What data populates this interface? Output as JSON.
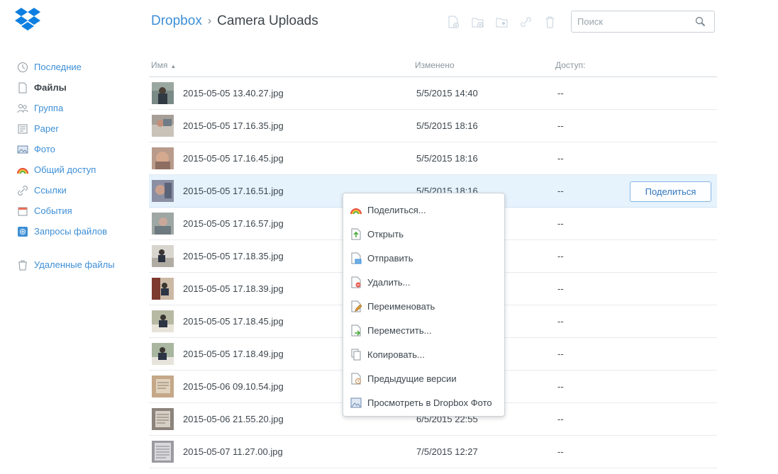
{
  "breadcrumb": {
    "root": "Dropbox",
    "separator": "›",
    "current": "Camera Uploads"
  },
  "search": {
    "placeholder": "Поиск",
    "value": ""
  },
  "toolbar": {
    "icons": [
      "new-file-icon",
      "new-folder-icon",
      "shared-folder-icon",
      "link-icon",
      "trash-icon"
    ]
  },
  "sidebar": {
    "items": [
      {
        "label": "Последние",
        "icon": "clock-icon"
      },
      {
        "label": "Файлы",
        "icon": "file-icon",
        "active": true
      },
      {
        "label": "Группа",
        "icon": "group-icon"
      },
      {
        "label": "Paper",
        "icon": "paper-icon"
      },
      {
        "label": "Фото",
        "icon": "photo-icon"
      },
      {
        "label": "Общий доступ",
        "icon": "rainbow-icon"
      },
      {
        "label": "Ссылки",
        "icon": "link-icon"
      },
      {
        "label": "События",
        "icon": "calendar-icon"
      },
      {
        "label": "Запросы файлов",
        "icon": "file-request-icon"
      },
      {
        "label": "Удаленные файлы",
        "icon": "trash-icon"
      }
    ]
  },
  "list": {
    "headers": {
      "name": "Имя",
      "sort_arrow": "▲",
      "modified": "Изменено",
      "access": "Доступ:"
    },
    "rows": [
      {
        "name": "2015-05-05 13.40.27.jpg",
        "modified": "5/5/2015 14:40",
        "access": "--"
      },
      {
        "name": "2015-05-05 17.16.35.jpg",
        "modified": "5/5/2015 18:16",
        "access": "--"
      },
      {
        "name": "2015-05-05 17.16.45.jpg",
        "modified": "5/5/2015 18:16",
        "access": "--"
      },
      {
        "name": "2015-05-05 17.16.51.jpg",
        "modified": "5/5/2015 18:16",
        "access": "--",
        "selected": true
      },
      {
        "name": "2015-05-05 17.16.57.jpg",
        "modified": "",
        "access": "--"
      },
      {
        "name": "2015-05-05 17.18.35.jpg",
        "modified": "",
        "access": "--"
      },
      {
        "name": "2015-05-05 17.18.39.jpg",
        "modified": "",
        "access": "--"
      },
      {
        "name": "2015-05-05 17.18.45.jpg",
        "modified": "",
        "access": "--"
      },
      {
        "name": "2015-05-05 17.18.49.jpg",
        "modified": "",
        "access": "--"
      },
      {
        "name": "2015-05-06 09.10.54.jpg",
        "modified": "",
        "access": "--"
      },
      {
        "name": "2015-05-06 21.55.20.jpg",
        "modified": "6/5/2015 22:55",
        "access": "--"
      },
      {
        "name": "2015-05-07 11.27.00.jpg",
        "modified": "7/5/2015 12:27",
        "access": "--"
      }
    ],
    "share_button": "Поделиться"
  },
  "context_menu": {
    "items": [
      {
        "label": "Поделиться...",
        "icon": "rainbow-icon"
      },
      {
        "label": "Открыть",
        "icon": "open-file-icon"
      },
      {
        "label": "Отправить",
        "icon": "send-file-icon"
      },
      {
        "label": "Удалить...",
        "icon": "delete-file-icon"
      },
      {
        "label": "Переименовать",
        "icon": "rename-file-icon"
      },
      {
        "label": "Переместить...",
        "icon": "move-file-icon"
      },
      {
        "label": "Копировать...",
        "icon": "copy-file-icon"
      },
      {
        "label": "Предыдущие версии",
        "icon": "versions-file-icon"
      },
      {
        "label": "Просмотреть в Dropbox Фото",
        "icon": "photo-icon"
      }
    ]
  },
  "colors": {
    "accent": "#3d8fd6",
    "selected_row": "#e6f2fc",
    "text": "#3d464d",
    "muted": "#8c979f"
  }
}
